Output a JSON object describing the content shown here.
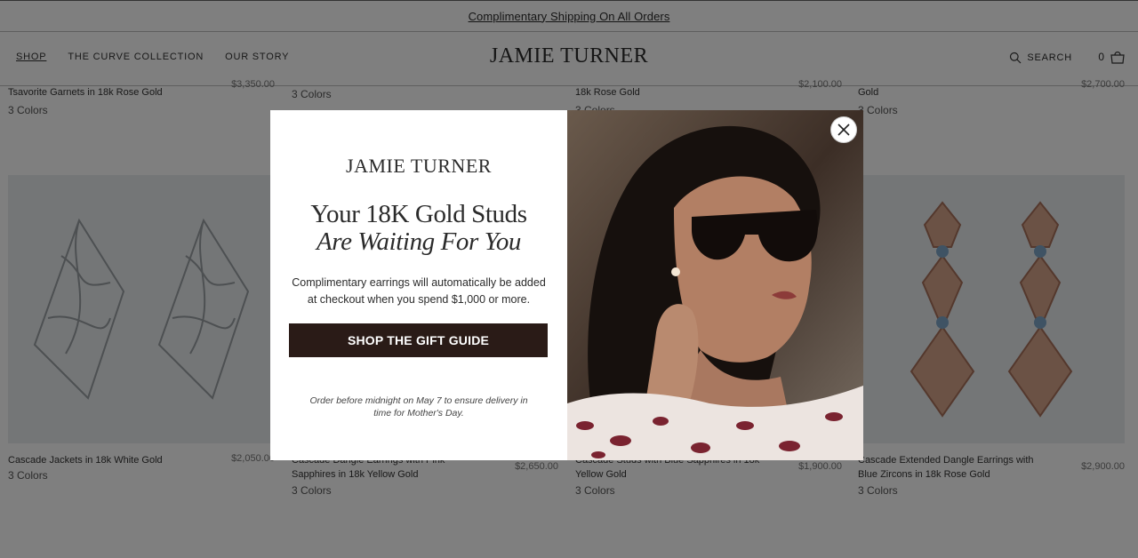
{
  "announcement": {
    "text": "Complimentary Shipping On All Orders"
  },
  "header": {
    "nav": [
      {
        "label": "SHOP",
        "active": true
      },
      {
        "label": "THE CURVE COLLECTION",
        "active": false
      },
      {
        "label": "OUR STORY",
        "active": false
      }
    ],
    "logo": "JAMIE TURNER",
    "search_label": "SEARCH",
    "cart_count": "0"
  },
  "top_row": [
    {
      "name": "Tsavorite Garnets in 18k Rose Gold",
      "colors": "3 Colors",
      "price": "$3,350.00"
    },
    {
      "name": "",
      "colors": "3 Colors",
      "price": ""
    },
    {
      "name": "18k Rose Gold",
      "colors": "3 Colors",
      "price": "$2,100.00"
    },
    {
      "name": "Gold",
      "colors": "3 Colors",
      "price": "$2,700.00"
    }
  ],
  "products": [
    {
      "name": "Cascade Jackets in 18k White Gold",
      "price": "$2,050.00",
      "colors": "3 Colors"
    },
    {
      "name": "Cascade Dangle Earrings with Pink Sapphires in 18k Yellow Gold",
      "price": "$2,650.00",
      "colors": "3 Colors"
    },
    {
      "name": "Cascade Studs with Blue Sapphires in 18k Yellow Gold",
      "price": "$1,900.00",
      "colors": "3 Colors"
    },
    {
      "name": "Cascade Extended Dangle Earrings with Blue Zircons in 18k Rose Gold",
      "price": "$2,900.00",
      "colors": "3 Colors"
    }
  ],
  "modal": {
    "logo": "JAMIE TURNER",
    "headline_line1": "Your 18K Gold Studs",
    "headline_line2": "Are Waiting For You",
    "body": "Complimentary earrings will automatically be added at checkout when you spend $1,000 or more.",
    "cta_label": "SHOP THE GIFT GUIDE",
    "note": "Order before midnight on May 7 to ensure delivery in time for Mother's Day.",
    "close_icon": "close-icon"
  },
  "colors": {
    "overlay": "rgba(0,0,0,0.5)",
    "cta_bg": "#2a1b17",
    "card_bg": "#e9ecef",
    "rose_gold": "#c98f73"
  }
}
